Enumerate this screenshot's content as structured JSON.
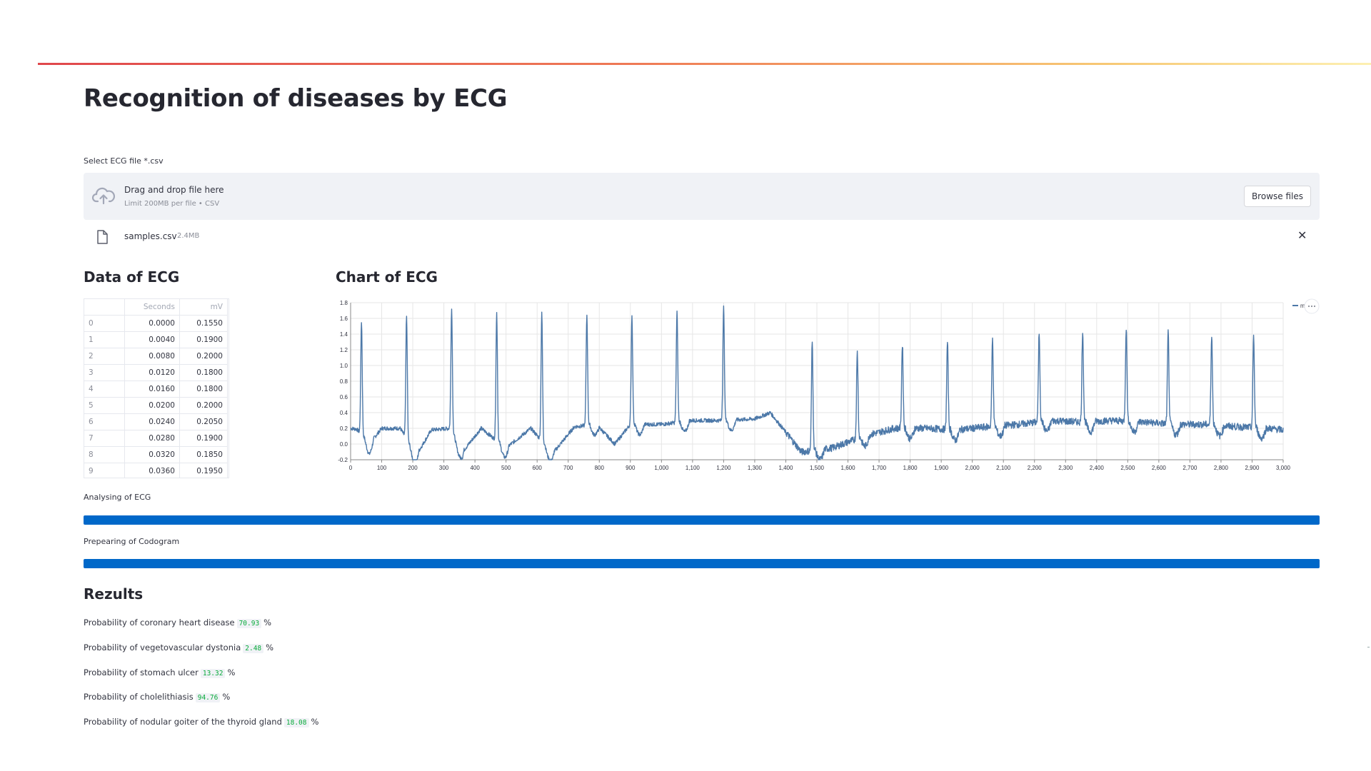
{
  "page": {
    "title": "Recognition of diseases by ECG"
  },
  "uploader": {
    "label": "Select ECG file *.csv",
    "drop_title": "Drag and drop file here",
    "drop_sub": "Limit 200MB per file • CSV",
    "browse_label": "Browse files",
    "file_name": "samples.csv",
    "file_size": "2.4MB",
    "close_symbol": "✕"
  },
  "icons": {
    "upload": "cloud-upload-icon",
    "file": "file-icon",
    "close": "close-icon",
    "menu": "more-horizontal-icon"
  },
  "data_section": {
    "title": "Data of ECG",
    "columns": [
      "",
      "Seconds",
      "mV"
    ],
    "rows": [
      [
        "0",
        "0.0000",
        "0.1550"
      ],
      [
        "1",
        "0.0040",
        "0.1900"
      ],
      [
        "2",
        "0.0080",
        "0.2000"
      ],
      [
        "3",
        "0.0120",
        "0.1800"
      ],
      [
        "4",
        "0.0160",
        "0.1800"
      ],
      [
        "5",
        "0.0200",
        "0.2000"
      ],
      [
        "6",
        "0.0240",
        "0.2050"
      ],
      [
        "7",
        "0.0280",
        "0.1900"
      ],
      [
        "8",
        "0.0320",
        "0.1850"
      ],
      [
        "9",
        "0.0360",
        "0.1950"
      ]
    ]
  },
  "chart_section": {
    "title": "Chart of ECG"
  },
  "chart_data": {
    "type": "line",
    "title": "",
    "xlabel": "",
    "ylabel": "",
    "xlim": [
      0,
      3000
    ],
    "ylim": [
      -0.2,
      1.8
    ],
    "x_ticks": [
      "0",
      "100",
      "200",
      "300",
      "400",
      "500",
      "600",
      "700",
      "800",
      "900",
      "1,000",
      "1,100",
      "1,200",
      "1,300",
      "1,400",
      "1,500",
      "1,600",
      "1,700",
      "1,800",
      "1,900",
      "2,000",
      "2,100",
      "2,200",
      "2,300",
      "2,400",
      "2,500",
      "2,600",
      "2,700",
      "2,800",
      "2,900",
      "3,000"
    ],
    "y_ticks": [
      "-0.2",
      "0.0",
      "0.2",
      "0.4",
      "0.6",
      "0.8",
      "1.0",
      "1.2",
      "1.4",
      "1.6",
      "1.8"
    ],
    "grid": true,
    "legend": "top-right",
    "color": "#4c78a8",
    "series": [
      {
        "name": "mV",
        "sampling_step": 1,
        "peaks": [
          [
            35,
            1.56
          ],
          [
            180,
            1.63
          ],
          [
            325,
            1.72
          ],
          [
            470,
            1.67
          ],
          [
            615,
            1.66
          ],
          [
            760,
            1.64
          ],
          [
            905,
            1.63
          ],
          [
            1050,
            1.68
          ],
          [
            1200,
            1.74
          ],
          [
            1485,
            1.3
          ],
          [
            1630,
            1.17
          ],
          [
            1775,
            1.27
          ],
          [
            1920,
            1.3
          ],
          [
            2065,
            1.34
          ],
          [
            2215,
            1.42
          ],
          [
            2355,
            1.45
          ],
          [
            2495,
            1.48
          ],
          [
            2630,
            1.42
          ],
          [
            2770,
            1.4
          ],
          [
            2905,
            1.38
          ]
        ],
        "baseline_points": [
          [
            0,
            0.2
          ],
          [
            20,
            0.19
          ],
          [
            60,
            0.0
          ],
          [
            100,
            0.2
          ],
          [
            160,
            0.2
          ],
          [
            210,
            -0.15
          ],
          [
            260,
            0.18
          ],
          [
            320,
            0.2
          ],
          [
            360,
            -0.1
          ],
          [
            420,
            0.2
          ],
          [
            500,
            -0.05
          ],
          [
            580,
            0.2
          ],
          [
            650,
            -0.12
          ],
          [
            720,
            0.22
          ],
          [
            790,
            0.25
          ],
          [
            850,
            0.0
          ],
          [
            900,
            0.25
          ],
          [
            1000,
            0.25
          ],
          [
            1100,
            0.3
          ],
          [
            1200,
            0.3
          ],
          [
            1300,
            0.32
          ],
          [
            1350,
            0.4
          ],
          [
            1450,
            -0.1
          ],
          [
            1550,
            -0.05
          ],
          [
            1650,
            0.1
          ],
          [
            1750,
            0.2
          ],
          [
            1850,
            0.2
          ],
          [
            1950,
            0.18
          ],
          [
            2050,
            0.22
          ],
          [
            2150,
            0.25
          ],
          [
            2250,
            0.3
          ],
          [
            2350,
            0.28
          ],
          [
            2450,
            0.3
          ],
          [
            2550,
            0.28
          ],
          [
            2650,
            0.25
          ],
          [
            2750,
            0.25
          ],
          [
            2850,
            0.22
          ],
          [
            2950,
            0.2
          ],
          [
            3000,
            0.18
          ]
        ]
      }
    ]
  },
  "progress": [
    {
      "label": "Analysing of ECG",
      "value": 1.0
    },
    {
      "label": "Prepearing of Codogram",
      "value": 1.0
    }
  ],
  "results": {
    "title": "Rezults",
    "items": [
      {
        "text": "Probability of coronary heart disease",
        "value": "70.93",
        "unit": "%"
      },
      {
        "text": "Probability of vegetovascular dystonia",
        "value": "2.48",
        "unit": "%"
      },
      {
        "text": "Probability of stomach ulcer",
        "value": "13.32",
        "unit": "%"
      },
      {
        "text": "Probability of cholelithiasis",
        "value": "94.76",
        "unit": "%"
      },
      {
        "text": "Probability of nodular goiter of the thyroid gland",
        "value": "18.08",
        "unit": "%"
      }
    ]
  }
}
